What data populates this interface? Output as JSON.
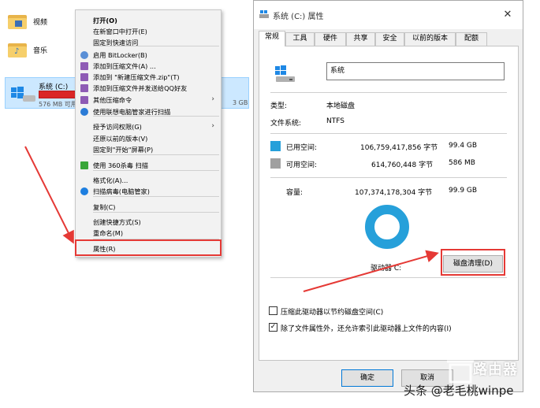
{
  "explorer": {
    "folders": [
      {
        "label": "视频",
        "icon": "video-folder-icon"
      },
      {
        "label": "音乐",
        "icon": "music-folder-icon"
      }
    ],
    "drive": {
      "name": "系统 (C:)",
      "free": "576 MB 可用,",
      "tail": "3 GB",
      "usage_fraction": 0.994,
      "bar_color": "#da2626"
    }
  },
  "context_menu": {
    "items": [
      {
        "label": "打开(O)",
        "bold": true
      },
      {
        "label": "在新窗口中打开(E)"
      },
      {
        "label": "固定到快速访问"
      },
      {
        "label": "启用 BitLocker(B)",
        "icon": "bitlocker-shield-icon"
      },
      {
        "label": "添加到压缩文件(A) ...",
        "icon": "archive-icon"
      },
      {
        "label": "添加到 \"新建压缩文件.zip\"(T)",
        "icon": "archive-icon"
      },
      {
        "label": "添加到压缩文件并发送给QQ好友",
        "icon": "archive-icon"
      },
      {
        "label": "其他压缩命令",
        "icon": "archive-icon",
        "submenu": true
      },
      {
        "label": "使用联想电脑管家进行扫描",
        "icon": "lenovo-scan-icon"
      },
      {
        "label": "授予访问权限(G)",
        "submenu": true
      },
      {
        "label": "还原以前的版本(V)"
      },
      {
        "label": "固定到\"开始\"屏幕(P)"
      },
      {
        "label": "使用 360杀毒 扫描",
        "icon": "360-antivirus-icon"
      },
      {
        "label": "格式化(A)..."
      },
      {
        "label": "扫描病毒(电脑管家)",
        "icon": "tencent-shield-icon"
      },
      {
        "label": "复制(C)"
      },
      {
        "label": "创建快捷方式(S)"
      },
      {
        "label": "重命名(M)"
      },
      {
        "label": "属性(R)"
      }
    ]
  },
  "dialog": {
    "title": "系统 (C:) 属性",
    "close_glyph": "✕",
    "tabs": [
      "常规",
      "工具",
      "硬件",
      "共享",
      "安全",
      "以前的版本",
      "配额"
    ],
    "active_tab": "常规",
    "drive_name_value": "系统",
    "type_label": "类型:",
    "type_value": "本地磁盘",
    "fs_label": "文件系统:",
    "fs_value": "NTFS",
    "used": {
      "label": "已用空间:",
      "bytes": "106,759,417,856 字节",
      "size": "99.4 GB",
      "color": "#26a0da"
    },
    "free": {
      "label": "可用空间:",
      "bytes": "614,760,448 字节",
      "size": "586 MB",
      "color": "#a0a0a0"
    },
    "capacity": {
      "label": "容量:",
      "bytes": "107,374,178,304 字节",
      "size": "99.9 GB"
    },
    "drive_letter_label": "驱动器 C:",
    "disk_cleanup_button": "磁盘清理(D)",
    "compress_checkbox": {
      "label": "压缩此驱动器以节约磁盘空间(C)",
      "checked": false
    },
    "index_checkbox": {
      "label": "除了文件属性外，还允许索引此驱动器上文件的内容(I)",
      "checked": true,
      "mark": "✓"
    },
    "ok_button": "确定",
    "cancel_button": "取消"
  },
  "watermark": {
    "brand": "路由器",
    "text": "头条 @老毛桃winpe"
  },
  "colors": {
    "highlight": "#e53935",
    "selection": "#cce8ff",
    "used_blue": "#26a0da"
  }
}
